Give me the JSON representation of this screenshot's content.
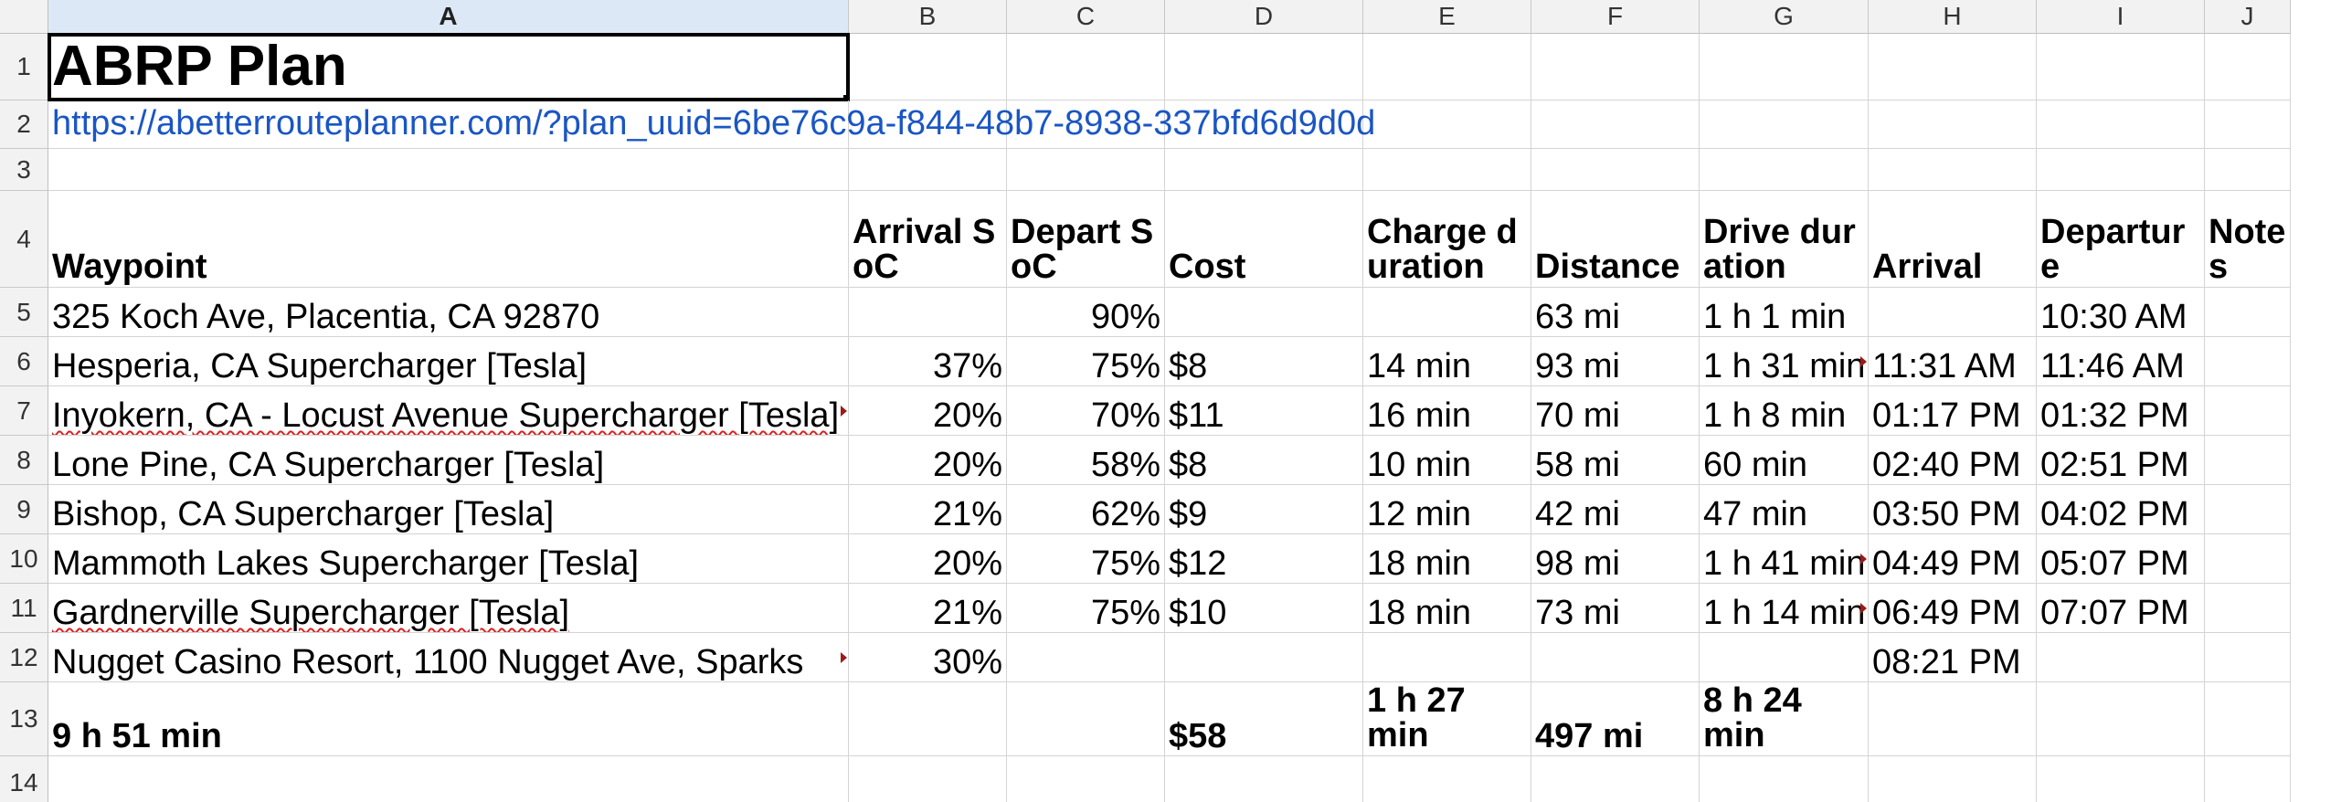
{
  "columns": [
    "A",
    "B",
    "C",
    "D",
    "E",
    "F",
    "G",
    "H",
    "I",
    "J"
  ],
  "rows": [
    "1",
    "2",
    "3",
    "4",
    "5",
    "6",
    "7",
    "8",
    "9",
    "10",
    "11",
    "12",
    "13",
    "14"
  ],
  "title": "ABRP Plan",
  "link": "https://abetterrouteplanner.com/?plan_uuid=6be76c9a-f844-48b7-8938-337bfd6d9d0d",
  "headers": {
    "waypoint": "Waypoint",
    "arrival_soc": "Arrival SoC",
    "depart_soc": "Depart SoC",
    "cost": "Cost",
    "charge_duration": "Charge duration",
    "distance": "Distance",
    "drive_duration": "Drive duration",
    "arrival": "Arrival",
    "departure": "Departure",
    "notes": "Notes"
  },
  "stops": [
    {
      "waypoint": "325 Koch Ave, Placentia, CA 92870",
      "arrival_soc": "",
      "depart_soc": "90%",
      "cost": "",
      "charge": "",
      "distance": "63 mi",
      "drive": "1 h 1 min",
      "arrival": "",
      "departure": "10:30 AM",
      "notes": ""
    },
    {
      "waypoint": "Hesperia, CA Supercharger [Tesla]",
      "arrival_soc": "37%",
      "depart_soc": "75%",
      "cost": "$8",
      "charge": "14 min",
      "distance": "93 mi",
      "drive": "1 h 31 min",
      "arrival": "11:31 AM",
      "departure": "11:46 AM",
      "notes": ""
    },
    {
      "waypoint": "Inyokern, CA - Locust Avenue Supercharger [Tesla]",
      "arrival_soc": "20%",
      "depart_soc": "70%",
      "cost": "$11",
      "charge": "16 min",
      "distance": "70 mi",
      "drive": "1 h 8 min",
      "arrival": "01:17 PM",
      "departure": "01:32 PM",
      "notes": ""
    },
    {
      "waypoint": "Lone Pine, CA Supercharger [Tesla]",
      "arrival_soc": "20%",
      "depart_soc": "58%",
      "cost": "$8",
      "charge": "10 min",
      "distance": "58 mi",
      "drive": "60 min",
      "arrival": "02:40 PM",
      "departure": "02:51 PM",
      "notes": ""
    },
    {
      "waypoint": "Bishop, CA Supercharger [Tesla]",
      "arrival_soc": "21%",
      "depart_soc": "62%",
      "cost": "$9",
      "charge": "12 min",
      "distance": "42 mi",
      "drive": "47 min",
      "arrival": "03:50 PM",
      "departure": "04:02 PM",
      "notes": ""
    },
    {
      "waypoint": "Mammoth Lakes Supercharger [Tesla]",
      "arrival_soc": "20%",
      "depart_soc": "75%",
      "cost": "$12",
      "charge": "18 min",
      "distance": "98 mi",
      "drive": "1 h 41 min",
      "arrival": "04:49 PM",
      "departure": "05:07 PM",
      "notes": ""
    },
    {
      "waypoint": "Gardnerville Supercharger [Tesla]",
      "arrival_soc": "21%",
      "depart_soc": "75%",
      "cost": "$10",
      "charge": "18 min",
      "distance": "73 mi",
      "drive": "1 h 14 min",
      "arrival": "06:49 PM",
      "departure": "07:07 PM",
      "notes": ""
    },
    {
      "waypoint": "Nugget Casino Resort, 1100 Nugget Ave, Sparks",
      "arrival_soc": "30%",
      "depart_soc": "",
      "cost": "",
      "charge": "",
      "distance": "",
      "drive": "",
      "arrival": "08:21 PM",
      "departure": "",
      "notes": ""
    }
  ],
  "totals": {
    "duration": "9 h 51 min",
    "cost": "$58",
    "charge": "1 h 27 min",
    "distance": "497 mi",
    "drive": "8 h 24 min"
  }
}
